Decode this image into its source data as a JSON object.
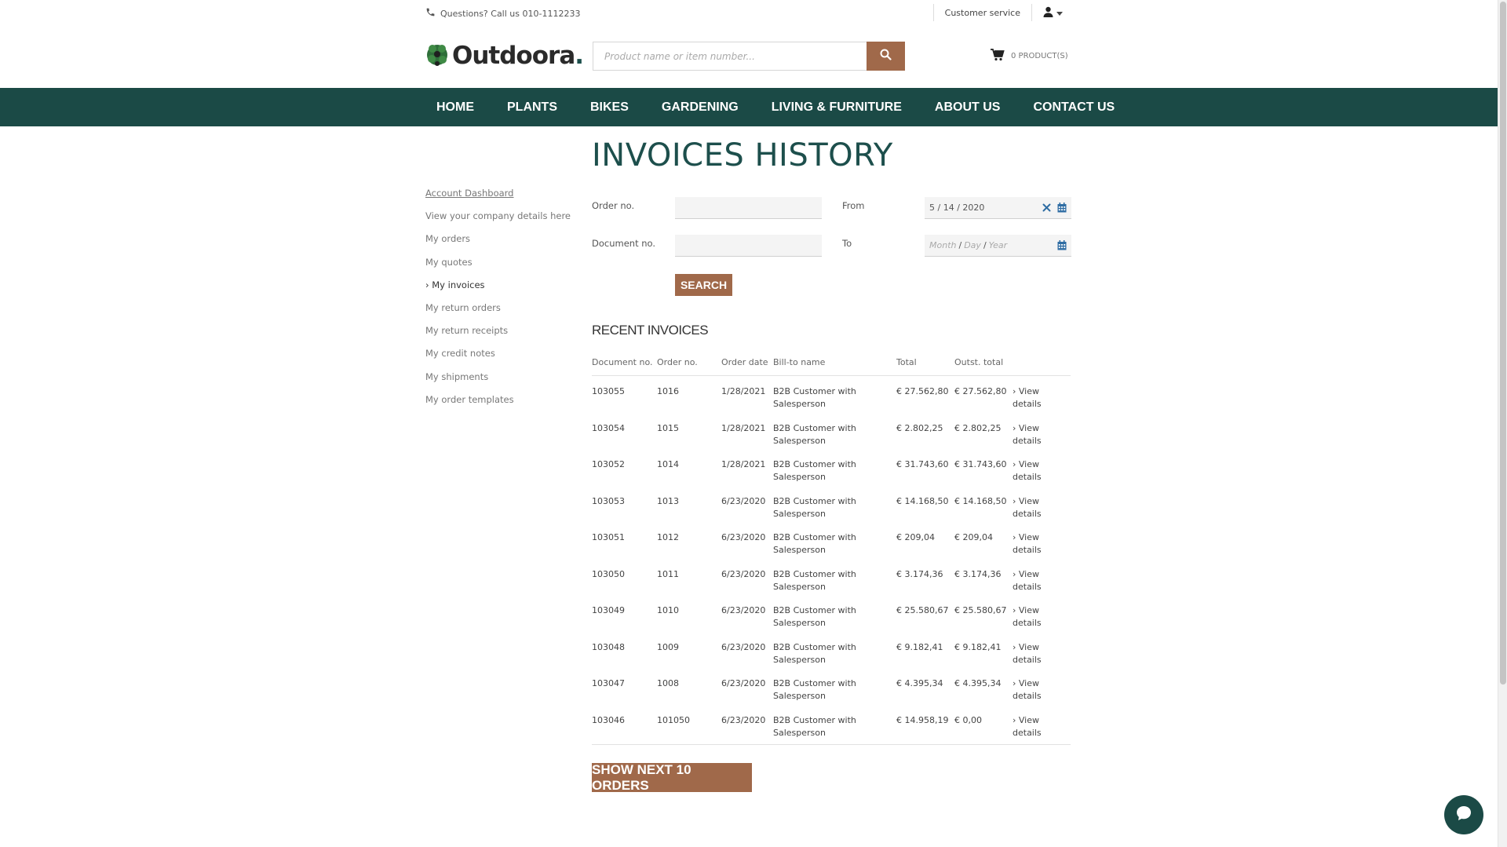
{
  "topbar": {
    "phone_text": "Questions? Call us 010-1112233",
    "customer_service": "Customer service"
  },
  "header": {
    "logo_text": "Outdoora",
    "logo_dot": ".",
    "search_placeholder": "Product name or item number...",
    "cart_text": "0 PRODUCT(S)"
  },
  "nav": {
    "items": [
      "HOME",
      "PLANTS",
      "BIKES",
      "GARDENING",
      "LIVING & FURNITURE",
      "ABOUT US",
      "CONTACT US"
    ]
  },
  "sidebar": {
    "items": [
      {
        "label": "Account Dashboard"
      },
      {
        "label": "View your company details here"
      },
      {
        "label": "My orders"
      },
      {
        "label": "My quotes"
      },
      {
        "label": "› My invoices"
      },
      {
        "label": "My return orders"
      },
      {
        "label": "My return receipts"
      },
      {
        "label": "My credit notes"
      },
      {
        "label": "My shipments"
      },
      {
        "label": "My order templates"
      }
    ]
  },
  "page": {
    "title": "INVOICES HISTORY"
  },
  "filters": {
    "order_no_label": "Order no.",
    "document_no_label": "Document no.",
    "from_label": "From",
    "to_label": "To",
    "from_value": "5 / 14 / 2020",
    "to_month": "Month",
    "to_day": "Day",
    "to_year": "Year",
    "search_button": "SEARCH"
  },
  "recent": {
    "title": "RECENT INVOICES",
    "columns": [
      "Document no.",
      "Order no.",
      "Order date",
      "Bill-to name",
      "Total",
      "Outst. total"
    ],
    "rows": [
      {
        "doc": "103055",
        "order": "1016",
        "date": "1/28/2021",
        "bill": "B2B Customer with Salesperson",
        "total": "€ 27.562,80",
        "outst": "€ 27.562,80",
        "link": "› View details"
      },
      {
        "doc": "103054",
        "order": "1015",
        "date": "1/28/2021",
        "bill": "B2B Customer with Salesperson",
        "total": "€ 2.802,25",
        "outst": "€ 2.802,25",
        "link": "› View details"
      },
      {
        "doc": "103052",
        "order": "1014",
        "date": "1/28/2021",
        "bill": "B2B Customer with Salesperson",
        "total": "€ 31.743,60",
        "outst": "€ 31.743,60",
        "link": "› View details"
      },
      {
        "doc": "103053",
        "order": "1013",
        "date": "6/23/2020",
        "bill": "B2B Customer with Salesperson",
        "total": "€ 14.168,50",
        "outst": "€ 14.168,50",
        "link": "› View details"
      },
      {
        "doc": "103051",
        "order": "1012",
        "date": "6/23/2020",
        "bill": "B2B Customer with Salesperson",
        "total": "€ 209,04",
        "outst": "€ 209,04",
        "link": "› View details"
      },
      {
        "doc": "103050",
        "order": "1011",
        "date": "6/23/2020",
        "bill": "B2B Customer with Salesperson",
        "total": "€ 3.174,36",
        "outst": "€ 3.174,36",
        "link": "› View details"
      },
      {
        "doc": "103049",
        "order": "1010",
        "date": "6/23/2020",
        "bill": "B2B Customer with Salesperson",
        "total": "€ 25.580,67",
        "outst": "€ 25.580,67",
        "link": "› View details"
      },
      {
        "doc": "103048",
        "order": "1009",
        "date": "6/23/2020",
        "bill": "B2B Customer with Salesperson",
        "total": "€ 9.182,41",
        "outst": "€ 9.182,41",
        "link": "› View details"
      },
      {
        "doc": "103047",
        "order": "1008",
        "date": "6/23/2020",
        "bill": "B2B Customer with Salesperson",
        "total": "€ 4.395,34",
        "outst": "€ 4.395,34",
        "link": "› View details"
      },
      {
        "doc": "103046",
        "order": "101050",
        "date": "6/23/2020",
        "bill": "B2B Customer with Salesperson",
        "total": "€ 14.958,19",
        "outst": "€ 0,00",
        "link": "› View details"
      }
    ],
    "next_button": "SHOW NEXT 10 ORDERS"
  },
  "colors": {
    "brand": "#1b4a46",
    "accent": "#a0694a"
  },
  "icons": {
    "phone": "phone-icon",
    "user": "user-icon",
    "search": "search-icon",
    "cart": "cart-icon",
    "clear": "close-icon",
    "calendar": "calendar-icon",
    "chat": "chat-icon"
  }
}
